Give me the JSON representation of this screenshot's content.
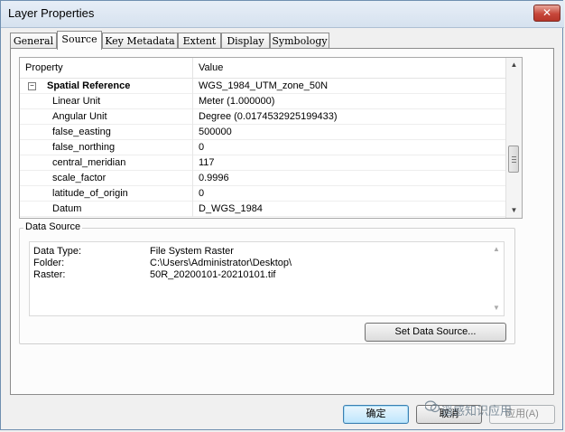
{
  "window": {
    "title": "Layer Properties",
    "close_glyph": "✕"
  },
  "tabs": [
    {
      "label": "General"
    },
    {
      "label": "Source"
    },
    {
      "label": "Key Metadata"
    },
    {
      "label": "Extent"
    },
    {
      "label": "Display"
    },
    {
      "label": "Symbology"
    }
  ],
  "active_tab": "Source",
  "grid": {
    "header": {
      "property": "Property",
      "value": "Value"
    },
    "group": {
      "expander": "−",
      "name": "Spatial Reference",
      "value": "WGS_1984_UTM_zone_50N"
    },
    "rows": [
      {
        "property": "Linear Unit",
        "value": "Meter (1.000000)"
      },
      {
        "property": "Angular Unit",
        "value": "Degree (0.0174532925199433)"
      },
      {
        "property": "false_easting",
        "value": "500000"
      },
      {
        "property": "false_northing",
        "value": "0"
      },
      {
        "property": "central_meridian",
        "value": "117"
      },
      {
        "property": "scale_factor",
        "value": "0.9996"
      },
      {
        "property": "latitude_of_origin",
        "value": "0"
      },
      {
        "property": "Datum",
        "value": "D_WGS_1984"
      }
    ],
    "scroll": {
      "up": "▲",
      "down": "▼"
    }
  },
  "data_source": {
    "label": "Data Source",
    "rows": [
      {
        "key": "Data Type:",
        "value": "File System Raster"
      },
      {
        "key": "Folder:",
        "value": "C:\\Users\\Administrator\\Desktop\\"
      },
      {
        "key": "Raster:",
        "value": "50R_20200101-20210101.tif"
      }
    ],
    "scroll": {
      "up": "▲",
      "down": "▼"
    },
    "set_button": "Set Data Source..."
  },
  "buttons": {
    "ok": "确定",
    "cancel": "取消",
    "apply": "应用(A)"
  },
  "watermark": {
    "text": "遥感知识应用"
  },
  "colors": {
    "accent": "#3c7fb1",
    "close": "#c7473a"
  }
}
